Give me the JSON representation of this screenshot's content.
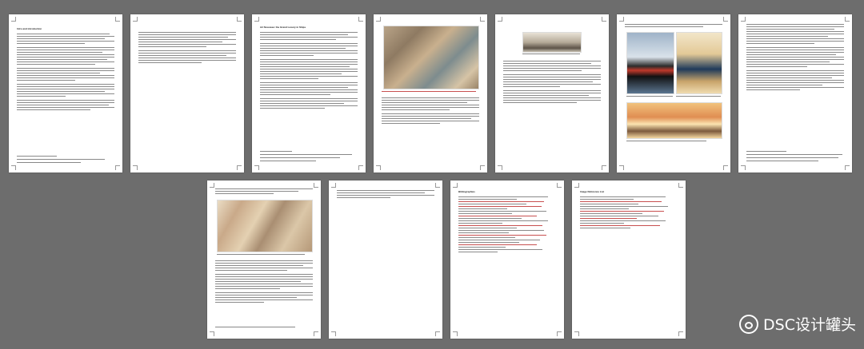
{
  "pages": [
    {
      "heading": "Intro and introduction"
    },
    {
      "heading": ""
    },
    {
      "heading": "Art Nouveau: the Grand Luxury in Ships"
    },
    {
      "heading": ""
    },
    {
      "heading": ""
    },
    {
      "heading": ""
    },
    {
      "heading": ""
    },
    {
      "heading": ""
    },
    {
      "heading": ""
    },
    {
      "heading": ""
    },
    {
      "heading": "Bibliographies"
    },
    {
      "heading": "Image Reference List"
    }
  ],
  "watermark": {
    "text": "DSC设计罐头",
    "icon": "wechat-icon"
  }
}
